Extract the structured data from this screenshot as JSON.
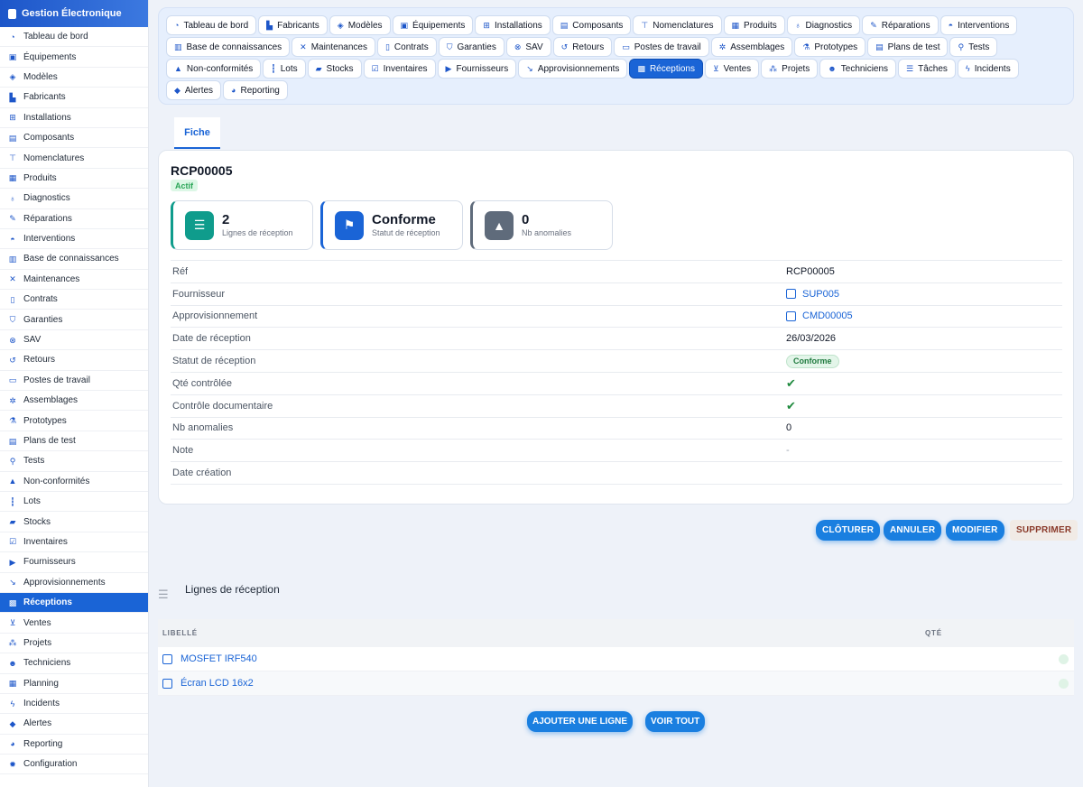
{
  "app": {
    "title": "Gestion Électronique"
  },
  "sidebar": {
    "items": [
      {
        "label": "Tableau de bord",
        "icon": "dashboard-icon"
      },
      {
        "label": "Équipements",
        "icon": "cube-icon"
      },
      {
        "label": "Modèles",
        "icon": "box-icon"
      },
      {
        "label": "Fabricants",
        "icon": "factory-icon"
      },
      {
        "label": "Installations",
        "icon": "network-icon"
      },
      {
        "label": "Composants",
        "icon": "memory-icon"
      },
      {
        "label": "Nomenclatures",
        "icon": "sitemap-icon"
      },
      {
        "label": "Produits",
        "icon": "package-icon"
      },
      {
        "label": "Diagnostics",
        "icon": "stethoscope-icon"
      },
      {
        "label": "Réparations",
        "icon": "wrench-icon"
      },
      {
        "label": "Interventions",
        "icon": "helmet-icon"
      },
      {
        "label": "Base de connaissances",
        "icon": "book-icon"
      },
      {
        "label": "Maintenances",
        "icon": "tools-icon"
      },
      {
        "label": "Contrats",
        "icon": "contract-icon"
      },
      {
        "label": "Garanties",
        "icon": "shield-icon"
      },
      {
        "label": "SAV",
        "icon": "support-icon"
      },
      {
        "label": "Retours",
        "icon": "undo-icon"
      },
      {
        "label": "Postes de travail",
        "icon": "desktop-icon"
      },
      {
        "label": "Assemblages",
        "icon": "gears-icon"
      },
      {
        "label": "Prototypes",
        "icon": "flask-icon"
      },
      {
        "label": "Plans de test",
        "icon": "clipboard-icon"
      },
      {
        "label": "Tests",
        "icon": "test-icon"
      },
      {
        "label": "Non-conformités",
        "icon": "warning-icon"
      },
      {
        "label": "Lots",
        "icon": "barcode-icon"
      },
      {
        "label": "Stocks",
        "icon": "warehouse-icon"
      },
      {
        "label": "Inventaires",
        "icon": "clipboard-check-icon"
      },
      {
        "label": "Fournisseurs",
        "icon": "truck-icon"
      },
      {
        "label": "Approvisionnements",
        "icon": "dolly-icon"
      },
      {
        "label": "Réceptions",
        "icon": "boxes-icon",
        "active": true
      },
      {
        "label": "Ventes",
        "icon": "cart-icon"
      },
      {
        "label": "Projets",
        "icon": "project-icon"
      },
      {
        "label": "Techniciens",
        "icon": "users-icon"
      },
      {
        "label": "Planning",
        "icon": "calendar-icon"
      },
      {
        "label": "Incidents",
        "icon": "bolt-icon"
      },
      {
        "label": "Alertes",
        "icon": "bell-icon"
      },
      {
        "label": "Reporting",
        "icon": "chart-pie-icon"
      },
      {
        "label": "Configuration",
        "icon": "cog-icon"
      }
    ]
  },
  "tabs": {
    "rows": [
      [
        {
          "label": "Tableau de bord",
          "icon": "dashboard-icon"
        },
        {
          "label": "Fabricants",
          "icon": "factory-icon"
        },
        {
          "label": "Modèles",
          "icon": "box-icon"
        },
        {
          "label": "Équipements",
          "icon": "cube-icon"
        },
        {
          "label": "Installations",
          "icon": "network-icon"
        },
        {
          "label": "Composants",
          "icon": "memory-icon"
        },
        {
          "label": "Nomenclatures",
          "icon": "sitemap-icon"
        },
        {
          "label": "Produits",
          "icon": "package-icon"
        },
        {
          "label": "Diagnostics",
          "icon": "stethoscope-icon"
        },
        {
          "label": "Réparations",
          "icon": "wrench-icon"
        },
        {
          "label": "Interventions",
          "icon": "helmet-icon"
        }
      ],
      [
        {
          "label": "Base de connaissances",
          "icon": "book-icon"
        },
        {
          "label": "Maintenances",
          "icon": "tools-icon"
        },
        {
          "label": "Contrats",
          "icon": "contract-icon"
        },
        {
          "label": "Garanties",
          "icon": "shield-icon"
        },
        {
          "label": "SAV",
          "icon": "support-icon"
        },
        {
          "label": "Retours",
          "icon": "undo-icon"
        },
        {
          "label": "Postes de travail",
          "icon": "desktop-icon"
        },
        {
          "label": "Assemblages",
          "icon": "gears-icon"
        },
        {
          "label": "Prototypes",
          "icon": "flask-icon"
        },
        {
          "label": "Plans de test",
          "icon": "clipboard-icon"
        },
        {
          "label": "Tests",
          "icon": "test-icon"
        }
      ],
      [
        {
          "label": "Non-conformités",
          "icon": "warning-icon"
        },
        {
          "label": "Lots",
          "icon": "barcode-icon"
        },
        {
          "label": "Stocks",
          "icon": "warehouse-icon"
        },
        {
          "label": "Inventaires",
          "icon": "clipboard-check-icon"
        },
        {
          "label": "Fournisseurs",
          "icon": "truck-icon"
        },
        {
          "label": "Approvisionnements",
          "icon": "dolly-icon"
        },
        {
          "label": "Réceptions",
          "icon": "boxes-icon",
          "active": true
        },
        {
          "label": "Ventes",
          "icon": "cart-icon"
        },
        {
          "label": "Projets",
          "icon": "project-icon"
        },
        {
          "label": "Techniciens",
          "icon": "users-icon"
        },
        {
          "label": "Tâches",
          "icon": "tasks-icon"
        },
        {
          "label": "Incidents",
          "icon": "bolt-icon"
        }
      ],
      [
        {
          "label": "Alertes",
          "icon": "bell-icon"
        },
        {
          "label": "Reporting",
          "icon": "chart-pie-icon"
        }
      ]
    ]
  },
  "subtab": {
    "label": "Fiche"
  },
  "record": {
    "title": "RCP00005",
    "status_badge": "Actif",
    "kpis": [
      {
        "value": "2",
        "label": "Lignes de réception",
        "icon": "list-icon",
        "color": "#0f9c8c"
      },
      {
        "value": "Conforme",
        "label": "Statut de réception",
        "icon": "flag-icon",
        "color": "#1a64d6"
      },
      {
        "value": "0",
        "label": "Nb anomalies",
        "icon": "warning-icon",
        "color": "#5f6b7b"
      }
    ],
    "fields": [
      {
        "label": "Réf",
        "value": "RCP00005",
        "type": "text"
      },
      {
        "label": "Fournisseur",
        "value": "SUP005",
        "type": "link"
      },
      {
        "label": "Approvisionnement",
        "value": "CMD00005",
        "type": "link"
      },
      {
        "label": "Date de réception",
        "value": "26/03/2026",
        "type": "text"
      },
      {
        "label": "Statut de réception",
        "value": "Conforme",
        "type": "pill"
      },
      {
        "label": "Qté contrôlée",
        "value": "✔",
        "type": "check"
      },
      {
        "label": "Contrôle documentaire",
        "value": "✔",
        "type": "check"
      },
      {
        "label": "Nb anomalies",
        "value": "0",
        "type": "text"
      },
      {
        "label": "Note",
        "value": "-",
        "type": "dash"
      },
      {
        "label": "Date création",
        "value": "",
        "type": "text"
      }
    ]
  },
  "actions": {
    "cloturer": "CLÔTURER",
    "annuler": "ANNULER",
    "modifier": "MODIFIER",
    "supprimer": "SUPPRIMER"
  },
  "lines_section": {
    "title": "Lignes de réception",
    "col_libelle": "LIBELLÉ",
    "col_qte": "QTÉ",
    "rows": [
      {
        "label": "MOSFET IRF540"
      },
      {
        "label": "Écran LCD 16x2"
      }
    ],
    "add_label": "AJOUTER UNE LIGNE",
    "view_all_label": "VOIR TOUT"
  }
}
